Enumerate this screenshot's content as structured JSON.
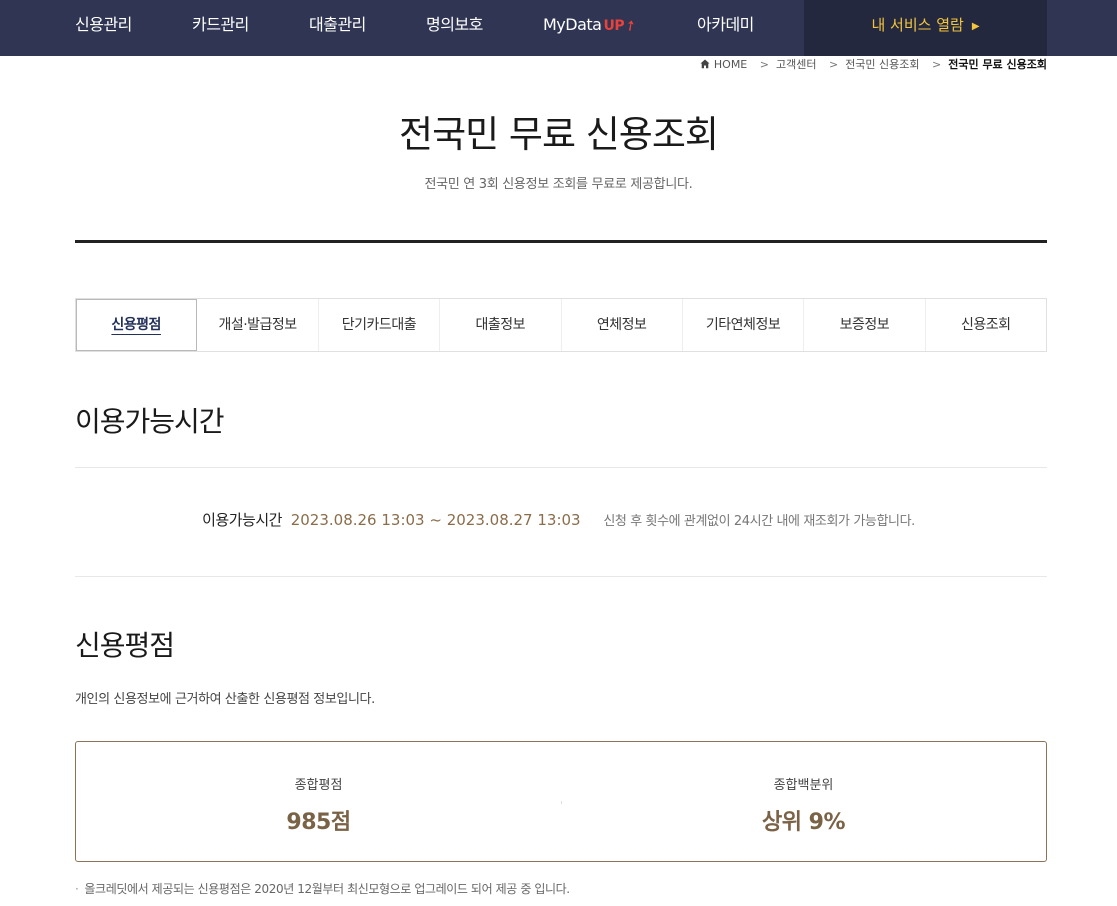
{
  "nav": {
    "items": [
      "신용관리",
      "카드관리",
      "대출관리",
      "명의보호"
    ],
    "mydata_label": "MyData",
    "mydata_badge": "UP",
    "academy": "아카데미",
    "service_button": "내 서비스 열람"
  },
  "breadcrumb": {
    "home": "HOME",
    "items": [
      "고객센터",
      "전국민 신용조회"
    ],
    "current": "전국민 무료 신용조회"
  },
  "page": {
    "title": "전국민 무료 신용조회",
    "subtitle": "전국민 연 3회 신용정보 조회를 무료로 제공합니다."
  },
  "tabs": [
    {
      "label": "신용평점",
      "active": true
    },
    {
      "label": "개설·발급정보",
      "active": false
    },
    {
      "label": "단기카드대출",
      "active": false
    },
    {
      "label": "대출정보",
      "active": false
    },
    {
      "label": "연체정보",
      "active": false
    },
    {
      "label": "기타연체정보",
      "active": false
    },
    {
      "label": "보증정보",
      "active": false
    },
    {
      "label": "신용조회",
      "active": false
    }
  ],
  "availability": {
    "heading": "이용가능시간",
    "label": "이용가능시간",
    "time_range": "2023.08.26 13:03 ~ 2023.08.27 13:03",
    "note": "신청 후 횟수에 관계없이 24시간 내에 재조회가 가능합니다."
  },
  "credit_score": {
    "heading": "신용평점",
    "description": "개인의 신용정보에 근거하여 산출한 신용평점 정보입니다.",
    "total_score_label": "종합평점",
    "total_score_value": "985점",
    "percentile_label": "종합백분위",
    "percentile_value": "상위 9%",
    "footnote": "올크레딧에서 제공되는 신용평점은 2020년 12월부터 최신모형으로 업그레이드 되어 제공 중 입니다."
  },
  "colors": {
    "nav_bg": "#2f3552",
    "service_bg": "#23283f",
    "service_text": "#f3c53c",
    "accent_brown": "#7a6246",
    "active_tab_text": "#23305a"
  }
}
